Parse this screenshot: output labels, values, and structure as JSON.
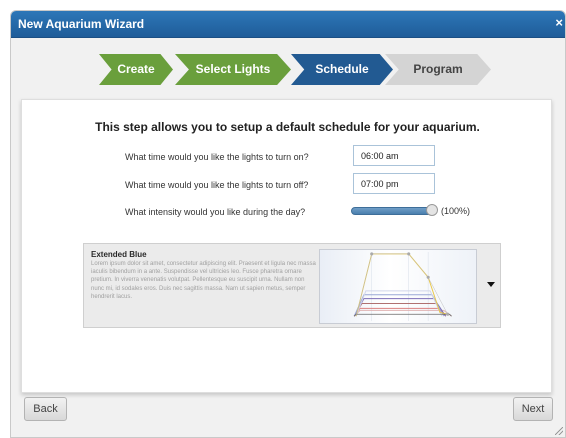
{
  "window": {
    "title": "New Aquarium Wizard",
    "close_glyph": "×"
  },
  "steps": [
    {
      "label": "Create",
      "state": "done"
    },
    {
      "label": "Select Lights",
      "state": "done"
    },
    {
      "label": "Schedule",
      "state": "active"
    },
    {
      "label": "Program",
      "state": "todo"
    }
  ],
  "colors": {
    "titlebar": "#2466a6",
    "step_done": "#6a9f3c",
    "step_active": "#225a92",
    "step_todo": "#d4d4d4"
  },
  "schedule": {
    "intro": "This step allows you to setup a default schedule for your aquarium.",
    "on_question": "What time would you like the lights to turn on?",
    "on_value": "06:00 am",
    "off_question": "What time would you like the lights to turn off?",
    "off_value": "07:00 pm",
    "intensity_question": "What intensity would you like during the day?",
    "intensity_level": 1.0,
    "intensity_label": "(100%)"
  },
  "profile": {
    "name": "Extended Blue",
    "description": "Lorem ipsum dolor sit amet, consectetur adipiscing elit. Praesent et ligula nec massa iaculis bibendum in a ante. Suspendisse vel ultricies leo. Fusce pharetra ornare pretium. In viverra venenatis volutpat. Pellentesque eu suscipit urna. Nullam non nunc mi, id sodales eros. Duis nec sagittis massa. Nam ut sapien metus, semper hendrerit lacus.",
    "dropdown_icon": "caret-down-icon"
  },
  "nav": {
    "back": "Back",
    "next": "Next"
  }
}
